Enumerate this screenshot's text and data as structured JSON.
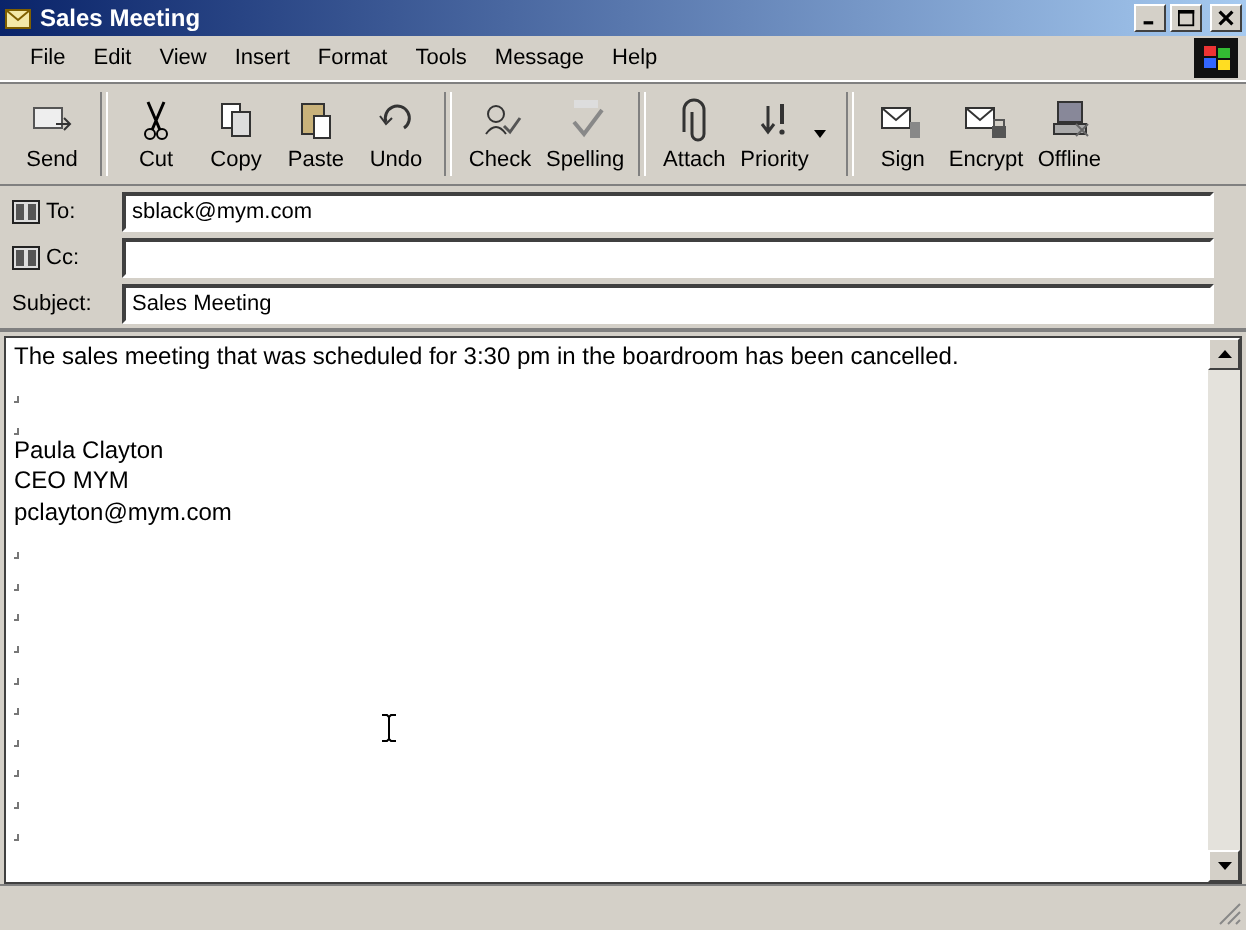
{
  "window": {
    "title": "Sales Meeting"
  },
  "menu": [
    "File",
    "Edit",
    "View",
    "Insert",
    "Format",
    "Tools",
    "Message",
    "Help"
  ],
  "toolbar": [
    [
      {
        "label": "Send"
      }
    ],
    [
      {
        "label": "Cut"
      },
      {
        "label": "Copy"
      },
      {
        "label": "Paste"
      },
      {
        "label": "Undo"
      }
    ],
    [
      {
        "label": "Check"
      },
      {
        "label": "Spelling"
      }
    ],
    [
      {
        "label": "Attach"
      },
      {
        "label": "Priority",
        "dropdown": true
      }
    ],
    [
      {
        "label": "Sign"
      },
      {
        "label": "Encrypt"
      },
      {
        "label": "Offline"
      }
    ]
  ],
  "fields": [
    {
      "label": "To:",
      "address_book": true,
      "value": "sblack@mym.com"
    },
    {
      "label": "Cc:",
      "address_book": true
    },
    {
      "label": "Subject:",
      "address_book": false,
      "value": "Sales Meeting"
    }
  ],
  "body": [
    {
      "kind": "text",
      "text": "The sales meeting that was scheduled for 3:30 pm in the boardroom has been cancelled."
    },
    {
      "kind": "blank"
    },
    {
      "kind": "blank"
    },
    {
      "kind": "text",
      "text": "Paula Clayton"
    },
    {
      "kind": "text",
      "text": "CEO MYM"
    },
    {
      "kind": "text",
      "text": "pclayton@mym.com"
    },
    {
      "kind": "blank"
    },
    {
      "kind": "blank"
    },
    {
      "kind": "blank"
    },
    {
      "kind": "blank"
    },
    {
      "kind": "blank"
    },
    {
      "kind": "blank"
    },
    {
      "kind": "blank"
    },
    {
      "kind": "blank"
    },
    {
      "kind": "blank"
    },
    {
      "kind": "blank"
    }
  ]
}
